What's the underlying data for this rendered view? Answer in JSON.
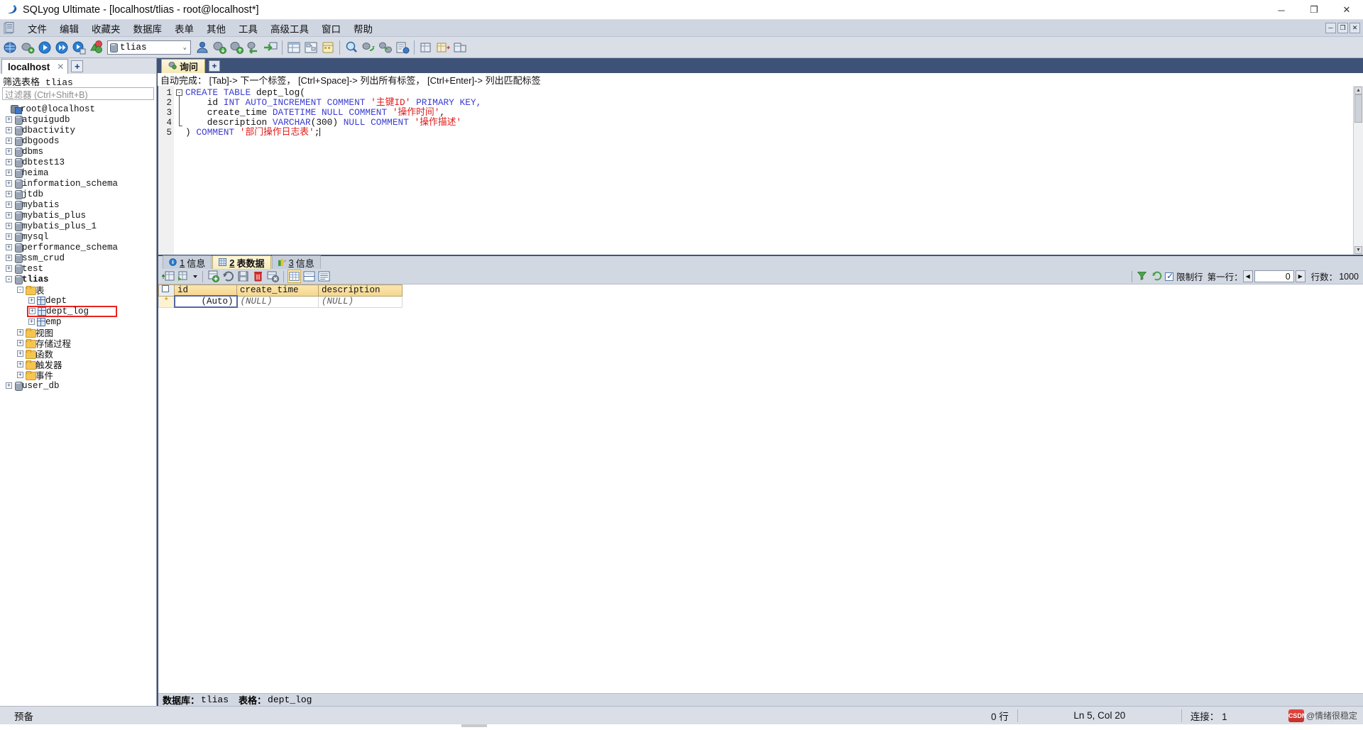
{
  "window": {
    "title": "SQLyog Ultimate - [localhost/tlias - root@localhost*]",
    "minimize": "─",
    "maximize": "❐",
    "close": "✕",
    "mdi_minimize": "─",
    "mdi_restore": "❐",
    "mdi_close": "✕"
  },
  "menu": {
    "items": [
      {
        "label": "文件"
      },
      {
        "label": "编辑"
      },
      {
        "label": "收藏夹"
      },
      {
        "label": "数据库"
      },
      {
        "label": "表单"
      },
      {
        "label": "其他"
      },
      {
        "label": "工具"
      },
      {
        "label": "高级工具"
      },
      {
        "label": "窗口"
      },
      {
        "label": "帮助"
      }
    ]
  },
  "toolbar": {
    "db_selector_value": "tlias",
    "db_selector_caret": "⌄"
  },
  "sidebar": {
    "connection_tab": "localhost",
    "connection_tab_close": "✕",
    "add_connection": "+",
    "filter_title_prefix": "筛选表格",
    "filter_title_db": "tlias",
    "filter_placeholder": "过滤器 (Ctrl+Shift+B)",
    "root": "root@localhost",
    "databases": [
      {
        "label": "atguigudb",
        "expander": "+"
      },
      {
        "label": "dbactivity",
        "expander": "+"
      },
      {
        "label": "dbgoods",
        "expander": "+"
      },
      {
        "label": "dbms",
        "expander": "+"
      },
      {
        "label": "dbtest13",
        "expander": "+"
      },
      {
        "label": "heima",
        "expander": "+"
      },
      {
        "label": "information_schema",
        "expander": "+"
      },
      {
        "label": "jtdb",
        "expander": "+"
      },
      {
        "label": "mybatis",
        "expander": "+"
      },
      {
        "label": "mybatis_plus",
        "expander": "+"
      },
      {
        "label": "mybatis_plus_1",
        "expander": "+"
      },
      {
        "label": "mysql",
        "expander": "+"
      },
      {
        "label": "performance_schema",
        "expander": "+"
      },
      {
        "label": "ssm_crud",
        "expander": "+"
      },
      {
        "label": "test",
        "expander": "+"
      }
    ],
    "active_db": {
      "label": "tlias",
      "expander": "-"
    },
    "tables_folder": {
      "label": "表",
      "expander": "-"
    },
    "tables": [
      {
        "label": "dept",
        "expander": "+",
        "highlighted": false
      },
      {
        "label": "dept_log",
        "expander": "+",
        "highlighted": true
      },
      {
        "label": "emp",
        "expander": "+",
        "highlighted": false
      }
    ],
    "folders": [
      {
        "label": "视图",
        "expander": "+"
      },
      {
        "label": "存储过程",
        "expander": "+"
      },
      {
        "label": "函数",
        "expander": "+"
      },
      {
        "label": "触发器",
        "expander": "+"
      },
      {
        "label": "事件",
        "expander": "+"
      }
    ],
    "other_db": {
      "label": "user_db",
      "expander": "+"
    },
    "highlight_color": "#e8251f"
  },
  "editor": {
    "tab_label": "询问",
    "add_tab": "+",
    "autocomplete_hint": "自动完成： [Tab]-> 下一个标签， [Ctrl+Space]-> 列出所有标签， [Ctrl+Enter]-> 列出匹配标签",
    "fold_marker": "-",
    "line_numbers": [
      "1",
      "2",
      "3",
      "4",
      "5"
    ],
    "sql_lines": [
      [
        {
          "t": "CREATE TABLE ",
          "c": "kw"
        },
        {
          "t": "dept_log(",
          "c": "plain"
        }
      ],
      [
        {
          "t": "    id ",
          "c": "plain"
        },
        {
          "t": "INT AUTO_INCREMENT COMMENT ",
          "c": "kw"
        },
        {
          "t": "'主键ID'",
          "c": "str"
        },
        {
          "t": " PRIMARY KEY,",
          "c": "kw"
        }
      ],
      [
        {
          "t": "    create_time ",
          "c": "plain"
        },
        {
          "t": "DATETIME NULL COMMENT ",
          "c": "kw"
        },
        {
          "t": "'操作时间'",
          "c": "str"
        },
        {
          "t": ",",
          "c": "plain"
        }
      ],
      [
        {
          "t": "    description ",
          "c": "plain"
        },
        {
          "t": "VARCHAR",
          "c": "kw"
        },
        {
          "t": "(300) ",
          "c": "plain"
        },
        {
          "t": "NULL COMMENT ",
          "c": "kw"
        },
        {
          "t": "'操作描述'",
          "c": "str"
        }
      ],
      [
        {
          "t": ") ",
          "c": "plain"
        },
        {
          "t": "COMMENT ",
          "c": "kw"
        },
        {
          "t": "'部门操作日志表'",
          "c": "str"
        },
        {
          "t": ";",
          "c": "plain"
        }
      ]
    ]
  },
  "results": {
    "tabs": [
      {
        "num": "1",
        "label": "信息",
        "active": false,
        "icon": "info-icon"
      },
      {
        "num": "2",
        "label": "表数据",
        "active": true,
        "icon": "grid-icon"
      },
      {
        "num": "3",
        "label": "信息",
        "active": false,
        "icon": "chart-icon"
      }
    ],
    "limit_label": "限制行",
    "first_row_label": "第一行：",
    "first_row_value": "0",
    "rows_label": "行数：",
    "rows_value": "1000",
    "prev_arrow": "◀",
    "next_arrow": "▶",
    "columns": [
      "id",
      "create_time",
      "description"
    ],
    "rows": [
      {
        "marker": "*",
        "cells": [
          "(Auto)",
          "(NULL)",
          "(NULL)"
        ]
      }
    ],
    "status_db_label": "数据库：",
    "status_db_value": "tlias",
    "status_table_label": "表格：",
    "status_table_value": "dept_log"
  },
  "statusbar": {
    "ready": "预备",
    "rows": "0 行",
    "cursor": "Ln 5, Col 20",
    "connection": "连接： 1",
    "watermark_logo": "CSDN",
    "watermark_text": "@情绪很稳定"
  }
}
